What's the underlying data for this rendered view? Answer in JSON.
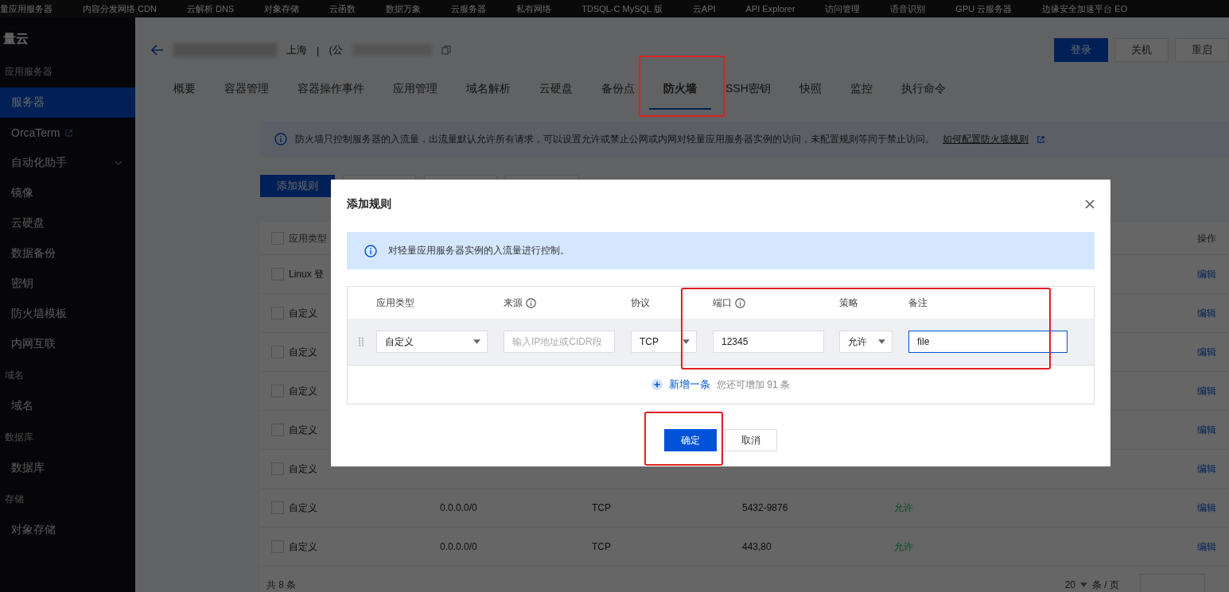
{
  "top_nav": [
    "量应用服务器",
    "内容分发网络 CDN",
    "云解析 DNS",
    "对象存储",
    "云函数",
    "数据万象",
    "云服务器",
    "私有网络",
    "TDSQL-C MySQL 版",
    "云API",
    "API Explorer",
    "访问管理",
    "语音识别",
    "GPU 云服务器",
    "边缘安全加速平台 EO"
  ],
  "sidebar": {
    "logo": "量云",
    "sections": [
      {
        "title": "应用服务器",
        "items": [
          {
            "label": "服务器",
            "selected": true
          },
          {
            "label": "OrcaTerm",
            "selected": false,
            "external": true
          },
          {
            "label": "自动化助手",
            "selected": false,
            "expanded": false
          },
          {
            "label": "镜像",
            "selected": false
          },
          {
            "label": "云硬盘",
            "selected": false
          },
          {
            "label": "数据备份",
            "selected": false
          },
          {
            "label": "密钥",
            "selected": false
          },
          {
            "label": "防火墙模板",
            "selected": false
          },
          {
            "label": "内网互联",
            "selected": false
          }
        ]
      },
      {
        "title": "域名",
        "items": [
          {
            "label": "域名",
            "selected": false
          }
        ]
      },
      {
        "title": "数据库",
        "items": [
          {
            "label": "数据库",
            "selected": false
          }
        ]
      },
      {
        "title": "存储",
        "items": [
          {
            "label": "对象存储",
            "selected": false
          }
        ]
      }
    ]
  },
  "header": {
    "location": "上海",
    "separator": "|",
    "address_prefix": "(公",
    "buttons": [
      {
        "label": "登录",
        "primary": true
      },
      {
        "label": "关机",
        "primary": false
      },
      {
        "label": "重启",
        "primary": false
      }
    ]
  },
  "tabs": [
    {
      "label": "概要",
      "selected": false
    },
    {
      "label": "容器管理",
      "selected": false
    },
    {
      "label": "容器操作事件",
      "selected": false
    },
    {
      "label": "应用管理",
      "selected": false
    },
    {
      "label": "域名解析",
      "selected": false
    },
    {
      "label": "云硬盘",
      "selected": false
    },
    {
      "label": "备份点",
      "selected": false
    },
    {
      "label": "防火墙",
      "selected": true
    },
    {
      "label": "SSH密钥",
      "selected": false
    },
    {
      "label": "快照",
      "selected": false
    },
    {
      "label": "监控",
      "selected": false
    },
    {
      "label": "执行命令",
      "selected": false
    }
  ],
  "notice": {
    "text": "防火墙只控制服务器的入流量，出流量默认允许所有请求，可以设置允许或禁止公网或内网对轻量应用服务器实例的访问，未配置规则等同于禁止访问。",
    "link": "如何配置防火墙规则"
  },
  "toolbar": {
    "add_button": "添加规则"
  },
  "table": {
    "header_checked": false,
    "columns": {
      "type": "应用类型",
      "actions": "操作"
    },
    "rows": [
      {
        "type": "Linux 登",
        "checked": false,
        "action": "编辑"
      },
      {
        "type": "自定义",
        "checked": false,
        "action": "编辑"
      },
      {
        "type": "自定义",
        "checked": false,
        "action": "编辑"
      },
      {
        "type": "自定义",
        "checked": false,
        "action": "编辑"
      },
      {
        "type": "自定义",
        "checked": false,
        "action": "编辑"
      },
      {
        "type": "自定义",
        "checked": false,
        "action": "编辑"
      },
      {
        "type": "自定义",
        "source": "0.0.0.0/0",
        "protocol": "TCP",
        "port": "5432-9876",
        "policy": "允许",
        "checked": false,
        "action": "编辑"
      },
      {
        "type": "自定义",
        "source": "0.0.0.0/0",
        "protocol": "TCP",
        "port": "443,80",
        "policy": "允许",
        "checked": false,
        "action": "编辑"
      }
    ],
    "total": "共 8 条",
    "page_size": "20",
    "per_page": "条 / 页"
  },
  "dialog": {
    "title": "添加规则",
    "info": "对轻量应用服务器实例的入流量进行控制。",
    "columns": [
      {
        "label": "应用类型",
        "help": false
      },
      {
        "label": "来源",
        "help": true
      },
      {
        "label": "协议",
        "help": false
      },
      {
        "label": "端口",
        "help": true
      },
      {
        "label": "策略",
        "help": false
      },
      {
        "label": "备注",
        "help": false
      }
    ],
    "rule": {
      "type": "自定义",
      "source_placeholder": "输入IP地址或CIDR段",
      "protocol": "TCP",
      "port": "12345",
      "policy": "允许",
      "remark": "file",
      "remark_focused": true
    },
    "add_link": "新增一条",
    "remaining": "您还可增加 91 条",
    "ok": "确定",
    "cancel": "取消"
  }
}
